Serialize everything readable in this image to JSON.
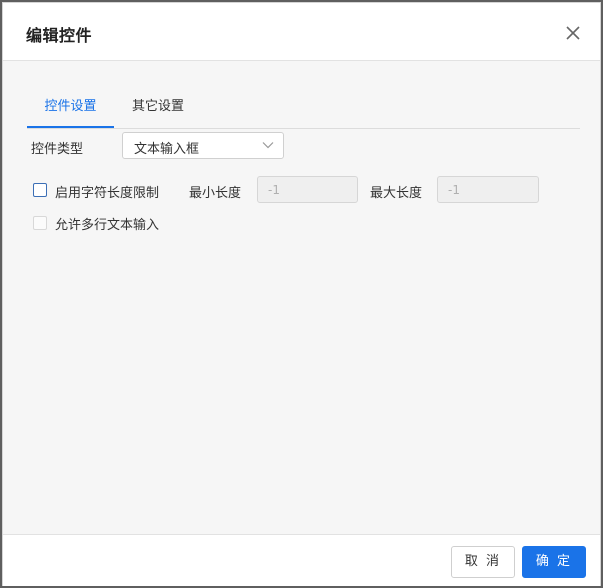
{
  "dialog": {
    "title": "编辑控件",
    "close_icon": "close-icon"
  },
  "tabs": [
    {
      "label": "控件设置",
      "active": true
    },
    {
      "label": "其它设置",
      "active": false
    }
  ],
  "control_type": {
    "label": "控件类型",
    "value": "文本输入框",
    "icon": "chevron-down-icon"
  },
  "length_limit": {
    "checkbox_label": "启用字符长度限制",
    "checked": false,
    "min_label": "最小长度",
    "min_value": "-1",
    "max_label": "最大长度",
    "max_value": "-1"
  },
  "multiline": {
    "checkbox_label": "允许多行文本输入",
    "checked": false,
    "enabled": false
  },
  "footer": {
    "cancel_label": "取 消",
    "ok_label": "确 定"
  },
  "colors": {
    "accent": "#1a73e8",
    "background": "#f6f6f6"
  }
}
